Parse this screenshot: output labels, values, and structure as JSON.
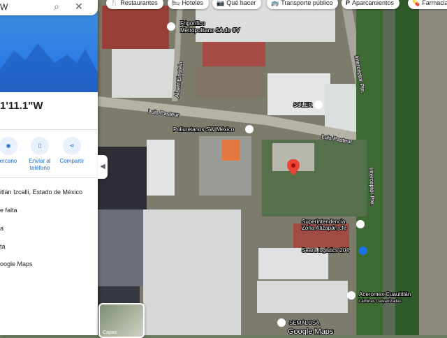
{
  "search": {
    "query": "W"
  },
  "place": {
    "coords_partial": "1'11.1\"W"
  },
  "actions": [
    {
      "label": "ercano"
    },
    {
      "label": "Enviar al teléfono"
    },
    {
      "label": "Compartir"
    }
  ],
  "info_rows": [
    {
      "text": "itlán Izcalli, Estado de México"
    },
    {
      "text": "e falta"
    },
    {
      "text": "a"
    },
    {
      "text": "ta"
    },
    {
      "text": "oogle Maps"
    }
  ],
  "chips": [
    {
      "label": "Restaurantes",
      "icon": "utensils-icon"
    },
    {
      "label": "Hoteles",
      "icon": "bed-icon"
    },
    {
      "label": "Qué hacer",
      "icon": "camera-icon"
    },
    {
      "label": "Transporte público",
      "icon": "bus-icon"
    },
    {
      "label": "Aparcamientos",
      "icon": "parking-icon"
    },
    {
      "label": "Farmacia",
      "icon": "pharmacy-icon"
    }
  ],
  "map_labels": {
    "frigorifico_1": "Frigorífico",
    "frigorifico_2": "Metropolitano SA de CV",
    "soler": "SOLER",
    "poliuretanos": "Poliuretanos SW México",
    "luis_pasteur_1": "Luis Pasteur",
    "luis_pasteur_2": "Luis Pasteur",
    "albert_einstein": "Albert Einstein",
    "interceptor_1": "Interceptor Pte.",
    "interceptor_2": "Interceptor Pte.",
    "superintendencia_1": "Superintendencia",
    "superintendencia_2": "Zona Atizapán cfe",
    "seara": "Seara logistics 204",
    "aceromex_1": "Aceromex Cuautitlán",
    "aceromex_2": "Láminas Galvanizadas",
    "semalusa": "SEMALUSA",
    "google_maps": "Google Maps"
  },
  "layers_label": "Capas",
  "colors": {
    "accent": "#1a73e8",
    "pin": "#ea4335",
    "action_bg": "#e8f0fe"
  }
}
